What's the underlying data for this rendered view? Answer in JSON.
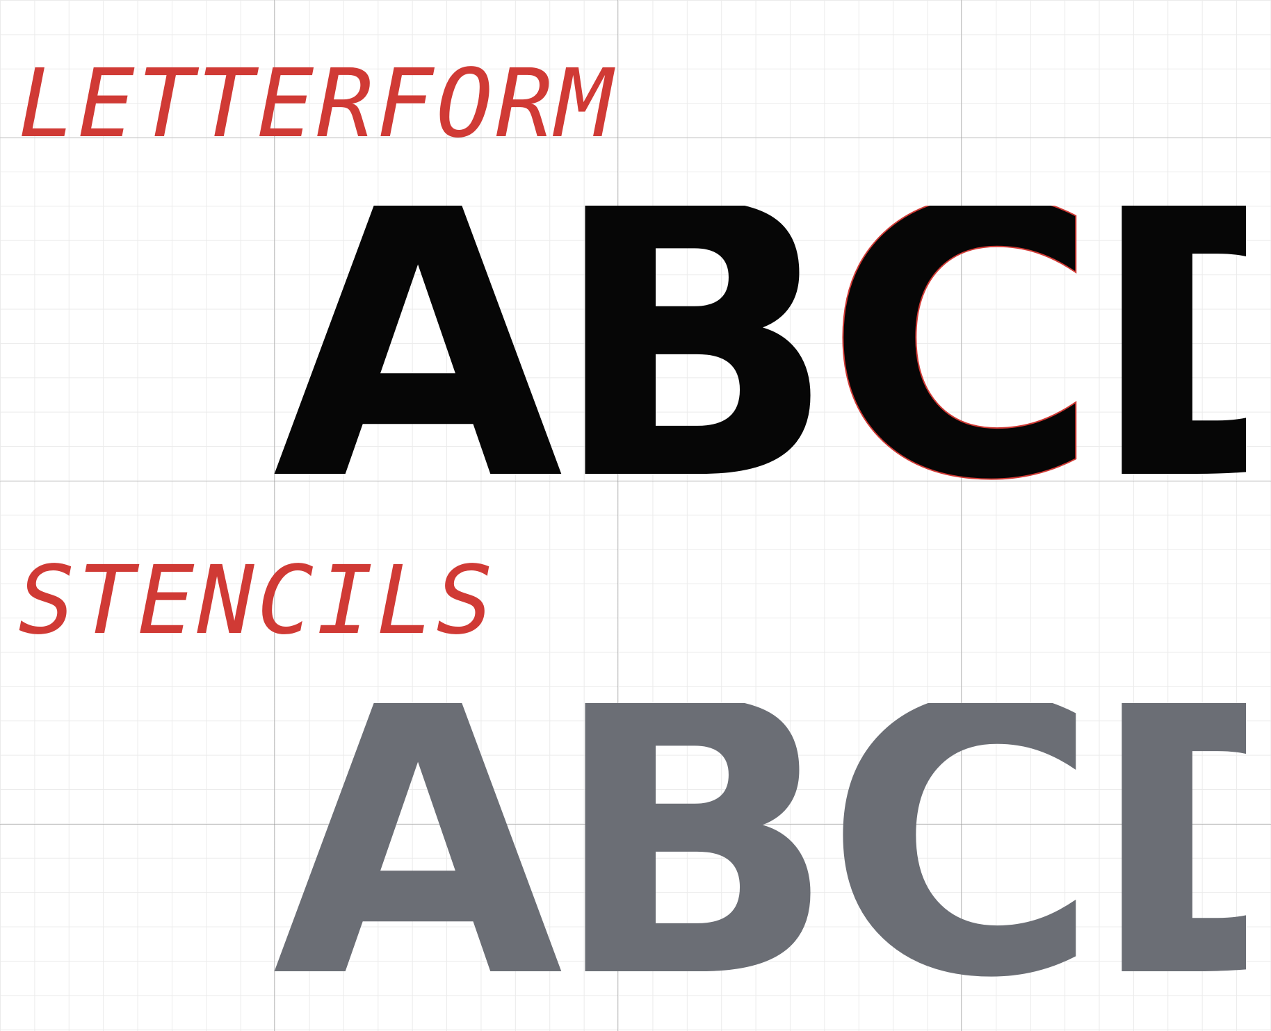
{
  "sections": [
    {
      "label": "LETTERFORM",
      "glyphs": [
        "A",
        "B",
        "C",
        "D"
      ]
    },
    {
      "label": "STENCILS",
      "glyphs": [
        "A",
        "B",
        "C",
        "D"
      ]
    }
  ],
  "colors": {
    "accent": "#d03a35",
    "glyph_dark": "#060606",
    "glyph_grey": "#6b6e75",
    "background": "#ffffff",
    "grid_minor": "#ebebeb",
    "grid_major": "#c4c4c4"
  }
}
